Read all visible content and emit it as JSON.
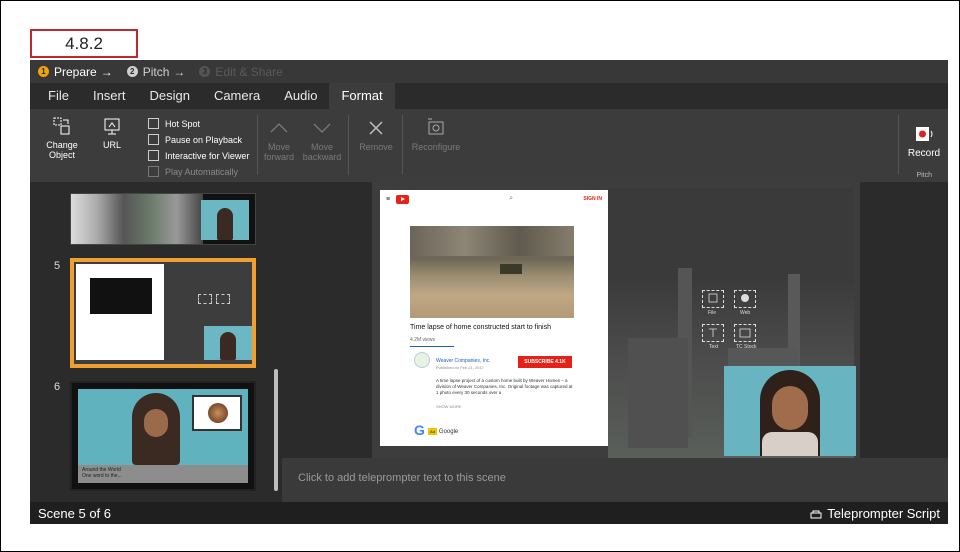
{
  "label": "4.8.2",
  "steps": [
    {
      "num": "1",
      "label": "Prepare",
      "arrow": "→"
    },
    {
      "num": "2",
      "label": "Pitch",
      "arrow": "→"
    },
    {
      "num": "3",
      "label": "Edit & Share",
      "arrow": ""
    }
  ],
  "menu": [
    "File",
    "Insert",
    "Design",
    "Camera",
    "Audio",
    "Format"
  ],
  "ribbon": {
    "change_object": "Change Object",
    "url": "URL",
    "checkboxes": [
      "Hot Spot",
      "Pause on Playback",
      "Interactive for Viewer",
      "Play Automatically"
    ],
    "move_forward": "Move forward",
    "move_backward": "Move backward",
    "remove": "Remove",
    "reconfigure": "Reconfigure",
    "record": "Record",
    "pitch_group": "Pitch"
  },
  "scenes": [
    {
      "num": ""
    },
    {
      "num": "5"
    },
    {
      "num": "6"
    }
  ],
  "scene6_caption": [
    "Around the World",
    "One word to the..."
  ],
  "youtube": {
    "signin": "SIGN IN",
    "title": "Time lapse of home constructed start to finish",
    "views": "4.2M views",
    "channel": "Weaver Companies, Inc.",
    "published": "Published on Feb 21, 2017",
    "subscribe": "SUBSCRIBE 4.1K",
    "description": "A time lapse project of a custom home built by Weaver Homes – a division of Weaver Companies, Inc. Original footage was captured at 1 photo every 30 seconds over a",
    "show_more": "SHOW MORE",
    "ad_badge": "Ad",
    "ad_name": "Google"
  },
  "placeholders": [
    "File",
    "Web",
    "Text",
    "TC Stock"
  ],
  "teleprompter_placeholder": "Click to add teleprompter text to this scene",
  "status": {
    "scene_counter": "Scene 5 of 6",
    "teleprompter_script": "Teleprompter Script"
  }
}
